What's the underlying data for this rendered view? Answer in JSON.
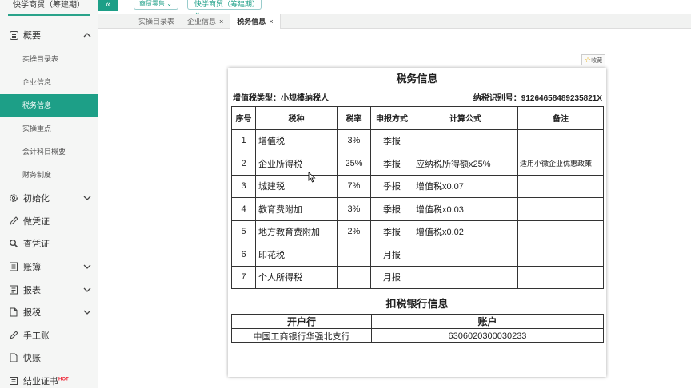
{
  "sidebar": {
    "title": "快学商贸（筹建期）",
    "overview": {
      "label": "概要",
      "items": [
        {
          "label": "实操目录表"
        },
        {
          "label": "企业信息"
        },
        {
          "label": "税务信息"
        },
        {
          "label": "实操重点"
        },
        {
          "label": "会计科目概要"
        },
        {
          "label": "财务制度"
        }
      ]
    },
    "menu": [
      {
        "label": "初始化"
      },
      {
        "label": "做凭证"
      },
      {
        "label": "查凭证"
      },
      {
        "label": "账簿"
      },
      {
        "label": "报表"
      },
      {
        "label": "报税"
      },
      {
        "label": "手工账"
      },
      {
        "label": "快账"
      },
      {
        "label": "结业证书"
      }
    ],
    "hot_badge": "HOT"
  },
  "topbar": {
    "collapse_label": "«",
    "dropdown1": "商贸零售",
    "dropdown2": "快学商贸（筹建期）"
  },
  "tabs": [
    {
      "label": "实操目录表"
    },
    {
      "label": "企业信息",
      "close": "×"
    },
    {
      "label": "税务信息",
      "close": "×"
    }
  ],
  "favorite_label": "收藏",
  "document": {
    "title": "税务信息",
    "vat_type_label": "增值税类型：小规模纳税人",
    "tax_id_label": "纳税识别号：91264658489235821X",
    "headers": [
      "序号",
      "税种",
      "税率",
      "申报方式",
      "计算公式",
      "备注"
    ],
    "rows": [
      {
        "no": "1",
        "tax": "增值税",
        "rate": "3%",
        "method": "季报",
        "formula": "",
        "note": ""
      },
      {
        "no": "2",
        "tax": "企业所得税",
        "rate": "25%",
        "method": "季报",
        "formula": "应纳税所得额x25%",
        "note": "适用小微企业优惠政策"
      },
      {
        "no": "3",
        "tax": "城建税",
        "rate": "7%",
        "method": "季报",
        "formula": "增值税x0.07",
        "note": ""
      },
      {
        "no": "4",
        "tax": "教育费附加",
        "rate": "3%",
        "method": "季报",
        "formula": "增值税x0.03",
        "note": ""
      },
      {
        "no": "5",
        "tax": "地方教育费附加",
        "rate": "2%",
        "method": "季报",
        "formula": "增值税x0.02",
        "note": ""
      },
      {
        "no": "6",
        "tax": "印花税",
        "rate": "",
        "method": "月报",
        "formula": "",
        "note": ""
      },
      {
        "no": "7",
        "tax": "个人所得税",
        "rate": "",
        "method": "月报",
        "formula": "",
        "note": ""
      }
    ],
    "bank_title": "扣税银行信息",
    "bank_headers": [
      "开户行",
      "账户"
    ],
    "bank_row": {
      "bank": "中国工商银行华强北支行",
      "account": "6306020300030233"
    }
  },
  "colors": {
    "accent": "#1d9f87"
  }
}
